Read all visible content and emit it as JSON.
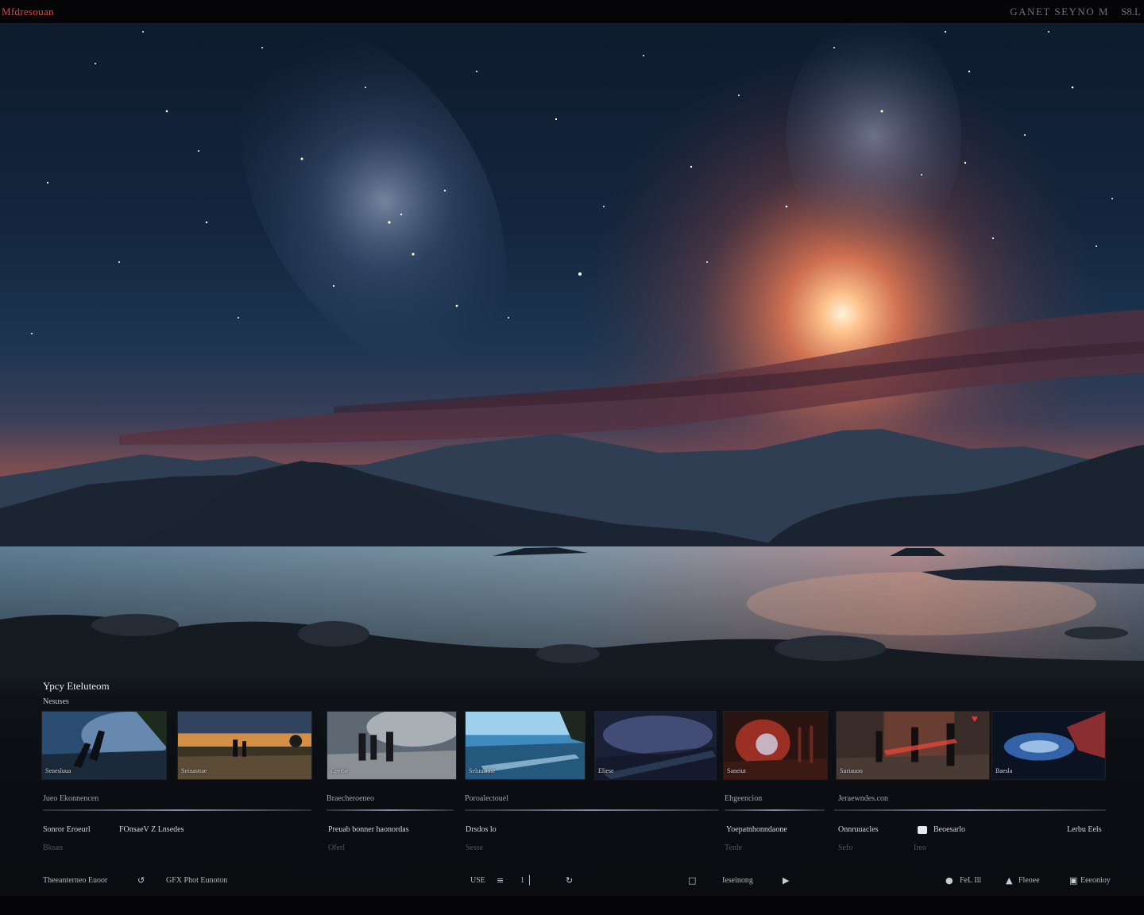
{
  "app": {
    "title": "Mfdresouan"
  },
  "window": {
    "title": "GANET SEYNO M",
    "control": "S8.L"
  },
  "library": {
    "title": "Ypcy Eteluteom",
    "subtitle": "Nesuses",
    "thumbnails": [
      {
        "caption": "Senesluua",
        "favorite": false
      },
      {
        "caption": "Seinasttae",
        "favorite": false
      },
      {
        "caption": "Ceerbe",
        "favorite": false
      },
      {
        "caption": "Seluuanhe",
        "favorite": false
      },
      {
        "caption": "Eliese",
        "favorite": false
      },
      {
        "caption": "Saneiut",
        "favorite": false
      },
      {
        "caption": "Suriauon",
        "favorite": true
      },
      {
        "caption": "Baesla",
        "favorite": false
      }
    ],
    "group_labels": [
      "Jueo Ekonnencen",
      "Braecheroeneo",
      "Poroalectouel",
      "Ehgeencion",
      "Jeraewndes.con"
    ],
    "item_titles": [
      "Sonror Eroeurl",
      "FOnsaeV Z Lnsedes",
      "Preuab bonner haonordas",
      "Drsdos lo",
      "Yoepatnhonndaone",
      "Onnruuacles",
      "Beoesarlo",
      "Lerbu Eels"
    ],
    "item_meta": [
      "Bksan",
      "Oferl",
      "Sesse",
      "Tenle",
      "Sefo",
      "Ireo"
    ]
  },
  "statusbar": {
    "left_label": "Theeanterneo Euoor",
    "left_value": "GFX Phot Eunoton",
    "center_label": "USE",
    "pager": "1",
    "step_label": "Ieseinong",
    "right_label": "FeL Ill",
    "right_count": "Fleoee",
    "right_end": "Eeeonioy"
  },
  "colors": {
    "accent": "#e2473e",
    "panel_bg": "#080a0e",
    "text_primary": "#e6e8ee",
    "text_muted": "#525760"
  }
}
